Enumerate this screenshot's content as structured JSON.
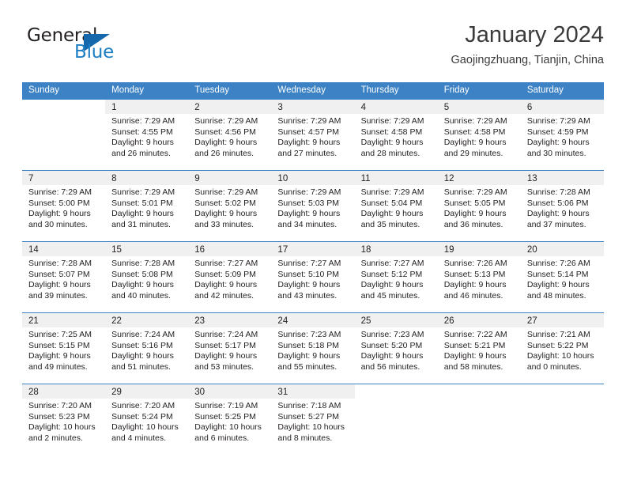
{
  "brand": {
    "line1": "General",
    "line2": "Blue",
    "triangle_icon": "triangle-icon",
    "blue": "#1c7fc4"
  },
  "header": {
    "month_title": "January 2024",
    "location": "Gaojingzhuang, Tianjin, China"
  },
  "calendar": {
    "header_bg": "#3c82c4",
    "daynum_band_bg": "#f0f0f0",
    "weekdays": [
      "Sunday",
      "Monday",
      "Tuesday",
      "Wednesday",
      "Thursday",
      "Friday",
      "Saturday"
    ],
    "weeks": [
      [
        {
          "day": "",
          "sunrise": "",
          "sunset": "",
          "daylight1": "",
          "daylight2": "",
          "empty": true
        },
        {
          "day": "1",
          "sunrise": "Sunrise: 7:29 AM",
          "sunset": "Sunset: 4:55 PM",
          "daylight1": "Daylight: 9 hours",
          "daylight2": "and 26 minutes."
        },
        {
          "day": "2",
          "sunrise": "Sunrise: 7:29 AM",
          "sunset": "Sunset: 4:56 PM",
          "daylight1": "Daylight: 9 hours",
          "daylight2": "and 26 minutes."
        },
        {
          "day": "3",
          "sunrise": "Sunrise: 7:29 AM",
          "sunset": "Sunset: 4:57 PM",
          "daylight1": "Daylight: 9 hours",
          "daylight2": "and 27 minutes."
        },
        {
          "day": "4",
          "sunrise": "Sunrise: 7:29 AM",
          "sunset": "Sunset: 4:58 PM",
          "daylight1": "Daylight: 9 hours",
          "daylight2": "and 28 minutes."
        },
        {
          "day": "5",
          "sunrise": "Sunrise: 7:29 AM",
          "sunset": "Sunset: 4:58 PM",
          "daylight1": "Daylight: 9 hours",
          "daylight2": "and 29 minutes."
        },
        {
          "day": "6",
          "sunrise": "Sunrise: 7:29 AM",
          "sunset": "Sunset: 4:59 PM",
          "daylight1": "Daylight: 9 hours",
          "daylight2": "and 30 minutes."
        }
      ],
      [
        {
          "day": "7",
          "sunrise": "Sunrise: 7:29 AM",
          "sunset": "Sunset: 5:00 PM",
          "daylight1": "Daylight: 9 hours",
          "daylight2": "and 30 minutes."
        },
        {
          "day": "8",
          "sunrise": "Sunrise: 7:29 AM",
          "sunset": "Sunset: 5:01 PM",
          "daylight1": "Daylight: 9 hours",
          "daylight2": "and 31 minutes."
        },
        {
          "day": "9",
          "sunrise": "Sunrise: 7:29 AM",
          "sunset": "Sunset: 5:02 PM",
          "daylight1": "Daylight: 9 hours",
          "daylight2": "and 33 minutes."
        },
        {
          "day": "10",
          "sunrise": "Sunrise: 7:29 AM",
          "sunset": "Sunset: 5:03 PM",
          "daylight1": "Daylight: 9 hours",
          "daylight2": "and 34 minutes."
        },
        {
          "day": "11",
          "sunrise": "Sunrise: 7:29 AM",
          "sunset": "Sunset: 5:04 PM",
          "daylight1": "Daylight: 9 hours",
          "daylight2": "and 35 minutes."
        },
        {
          "day": "12",
          "sunrise": "Sunrise: 7:29 AM",
          "sunset": "Sunset: 5:05 PM",
          "daylight1": "Daylight: 9 hours",
          "daylight2": "and 36 minutes."
        },
        {
          "day": "13",
          "sunrise": "Sunrise: 7:28 AM",
          "sunset": "Sunset: 5:06 PM",
          "daylight1": "Daylight: 9 hours",
          "daylight2": "and 37 minutes."
        }
      ],
      [
        {
          "day": "14",
          "sunrise": "Sunrise: 7:28 AM",
          "sunset": "Sunset: 5:07 PM",
          "daylight1": "Daylight: 9 hours",
          "daylight2": "and 39 minutes."
        },
        {
          "day": "15",
          "sunrise": "Sunrise: 7:28 AM",
          "sunset": "Sunset: 5:08 PM",
          "daylight1": "Daylight: 9 hours",
          "daylight2": "and 40 minutes."
        },
        {
          "day": "16",
          "sunrise": "Sunrise: 7:27 AM",
          "sunset": "Sunset: 5:09 PM",
          "daylight1": "Daylight: 9 hours",
          "daylight2": "and 42 minutes."
        },
        {
          "day": "17",
          "sunrise": "Sunrise: 7:27 AM",
          "sunset": "Sunset: 5:10 PM",
          "daylight1": "Daylight: 9 hours",
          "daylight2": "and 43 minutes."
        },
        {
          "day": "18",
          "sunrise": "Sunrise: 7:27 AM",
          "sunset": "Sunset: 5:12 PM",
          "daylight1": "Daylight: 9 hours",
          "daylight2": "and 45 minutes."
        },
        {
          "day": "19",
          "sunrise": "Sunrise: 7:26 AM",
          "sunset": "Sunset: 5:13 PM",
          "daylight1": "Daylight: 9 hours",
          "daylight2": "and 46 minutes."
        },
        {
          "day": "20",
          "sunrise": "Sunrise: 7:26 AM",
          "sunset": "Sunset: 5:14 PM",
          "daylight1": "Daylight: 9 hours",
          "daylight2": "and 48 minutes."
        }
      ],
      [
        {
          "day": "21",
          "sunrise": "Sunrise: 7:25 AM",
          "sunset": "Sunset: 5:15 PM",
          "daylight1": "Daylight: 9 hours",
          "daylight2": "and 49 minutes."
        },
        {
          "day": "22",
          "sunrise": "Sunrise: 7:24 AM",
          "sunset": "Sunset: 5:16 PM",
          "daylight1": "Daylight: 9 hours",
          "daylight2": "and 51 minutes."
        },
        {
          "day": "23",
          "sunrise": "Sunrise: 7:24 AM",
          "sunset": "Sunset: 5:17 PM",
          "daylight1": "Daylight: 9 hours",
          "daylight2": "and 53 minutes."
        },
        {
          "day": "24",
          "sunrise": "Sunrise: 7:23 AM",
          "sunset": "Sunset: 5:18 PM",
          "daylight1": "Daylight: 9 hours",
          "daylight2": "and 55 minutes."
        },
        {
          "day": "25",
          "sunrise": "Sunrise: 7:23 AM",
          "sunset": "Sunset: 5:20 PM",
          "daylight1": "Daylight: 9 hours",
          "daylight2": "and 56 minutes."
        },
        {
          "day": "26",
          "sunrise": "Sunrise: 7:22 AM",
          "sunset": "Sunset: 5:21 PM",
          "daylight1": "Daylight: 9 hours",
          "daylight2": "and 58 minutes."
        },
        {
          "day": "27",
          "sunrise": "Sunrise: 7:21 AM",
          "sunset": "Sunset: 5:22 PM",
          "daylight1": "Daylight: 10 hours",
          "daylight2": "and 0 minutes."
        }
      ],
      [
        {
          "day": "28",
          "sunrise": "Sunrise: 7:20 AM",
          "sunset": "Sunset: 5:23 PM",
          "daylight1": "Daylight: 10 hours",
          "daylight2": "and 2 minutes."
        },
        {
          "day": "29",
          "sunrise": "Sunrise: 7:20 AM",
          "sunset": "Sunset: 5:24 PM",
          "daylight1": "Daylight: 10 hours",
          "daylight2": "and 4 minutes."
        },
        {
          "day": "30",
          "sunrise": "Sunrise: 7:19 AM",
          "sunset": "Sunset: 5:25 PM",
          "daylight1": "Daylight: 10 hours",
          "daylight2": "and 6 minutes."
        },
        {
          "day": "31",
          "sunrise": "Sunrise: 7:18 AM",
          "sunset": "Sunset: 5:27 PM",
          "daylight1": "Daylight: 10 hours",
          "daylight2": "and 8 minutes."
        },
        {
          "day": "",
          "sunrise": "",
          "sunset": "",
          "daylight1": "",
          "daylight2": "",
          "empty": true
        },
        {
          "day": "",
          "sunrise": "",
          "sunset": "",
          "daylight1": "",
          "daylight2": "",
          "empty": true
        },
        {
          "day": "",
          "sunrise": "",
          "sunset": "",
          "daylight1": "",
          "daylight2": "",
          "empty": true
        }
      ]
    ]
  }
}
